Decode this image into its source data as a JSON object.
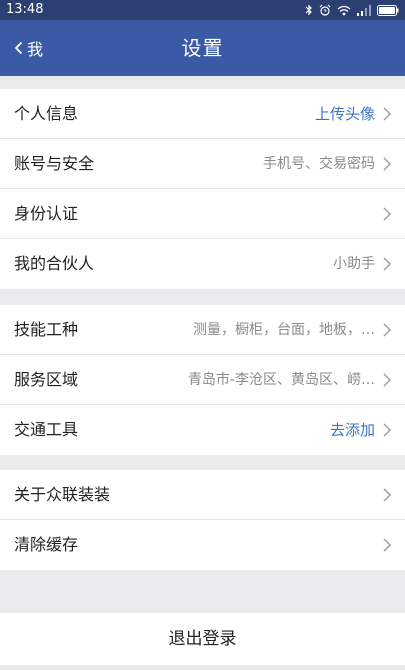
{
  "status_bar": {
    "time": "13:48",
    "icons": [
      "bluetooth-icon",
      "alarm-icon",
      "wifi-icon",
      "signal-icon",
      "battery-icon"
    ]
  },
  "nav": {
    "back_label": "我",
    "title": "设置"
  },
  "colors": {
    "status_bar": "#2b3f72",
    "nav_bar": "#3b5aa6",
    "accent_value": "#3b74c9",
    "secondary_value": "#8a8a8a",
    "background": "#e9eaec"
  },
  "groups": [
    {
      "items": [
        {
          "label": "个人信息",
          "value": "上传头像"
        },
        {
          "label": "账号与安全",
          "value": "手机号、交易密码"
        },
        {
          "label": "身份认证",
          "value": ""
        },
        {
          "label": "我的合伙人",
          "value": "小助手"
        }
      ]
    },
    {
      "items": [
        {
          "label": "技能工种",
          "value": "测量，橱柜，台面，地板，…"
        },
        {
          "label": "服务区域",
          "value": "青岛市-李沧区、黄岛区、崂…"
        },
        {
          "label": "交通工具",
          "value": "去添加"
        }
      ]
    },
    {
      "items": [
        {
          "label": "关于众联装装",
          "value": ""
        },
        {
          "label": "清除缓存",
          "value": ""
        }
      ]
    }
  ],
  "logout_label": "退出登录"
}
